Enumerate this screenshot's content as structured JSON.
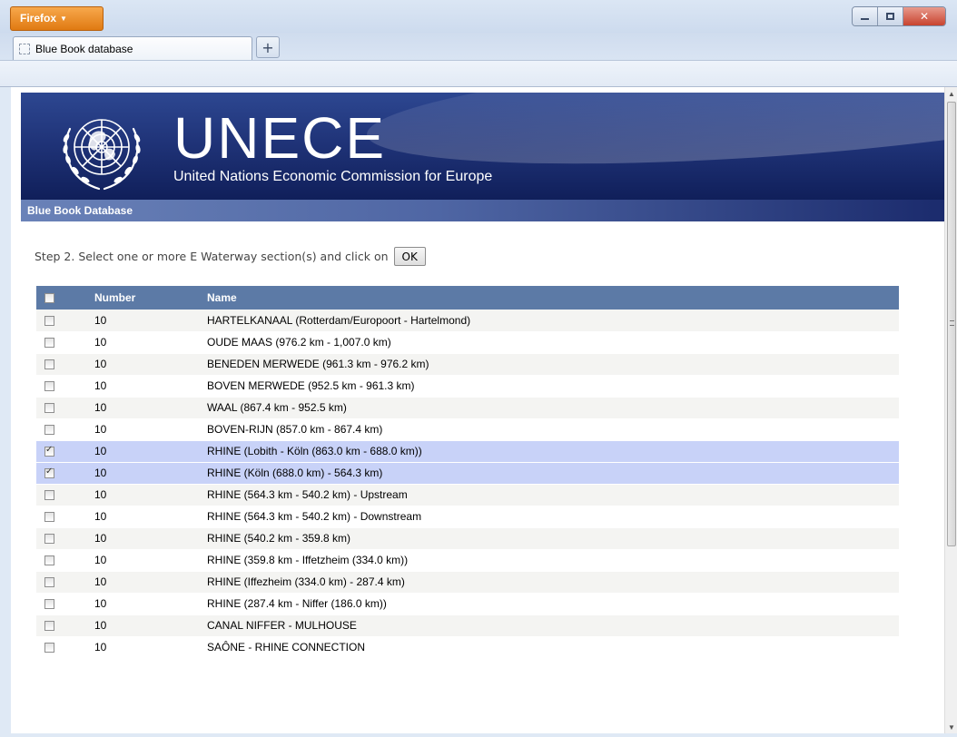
{
  "window": {
    "firefox_label": "Firefox",
    "tab_title": "Blue Book database",
    "new_tab_symbol": "+"
  },
  "banner": {
    "title": "UNECE",
    "subtitle": "United Nations Economic Commission for Europe",
    "section": "Blue Book Database"
  },
  "step": {
    "text": "Step 2. Select one or more E Waterway section(s) and click on",
    "ok_label": "OK"
  },
  "table": {
    "headers": [
      "Number",
      "Name"
    ],
    "rows": [
      {
        "checked": false,
        "number": "10",
        "name": "HARTELKANAAL (Rotterdam/Europoort - Hartelmond)"
      },
      {
        "checked": false,
        "number": "10",
        "name": "OUDE MAAS (976.2 km - 1,007.0 km)"
      },
      {
        "checked": false,
        "number": "10",
        "name": "BENEDEN MERWEDE (961.3 km - 976.2 km)"
      },
      {
        "checked": false,
        "number": "10",
        "name": "BOVEN MERWEDE (952.5 km - 961.3 km)"
      },
      {
        "checked": false,
        "number": "10",
        "name": "WAAL (867.4 km - 952.5 km)"
      },
      {
        "checked": false,
        "number": "10",
        "name": "BOVEN-RIJN (857.0 km - 867.4 km)"
      },
      {
        "checked": true,
        "number": "10",
        "name": "RHINE (Lobith - Köln (863.0 km - 688.0 km))"
      },
      {
        "checked": true,
        "number": "10",
        "name": "RHINE (Köln (688.0 km) - 564.3 km)"
      },
      {
        "checked": false,
        "number": "10",
        "name": "RHINE (564.3 km - 540.2 km) - Upstream"
      },
      {
        "checked": false,
        "number": "10",
        "name": "RHINE (564.3 km - 540.2 km) - Downstream"
      },
      {
        "checked": false,
        "number": "10",
        "name": "RHINE (540.2 km - 359.8 km)"
      },
      {
        "checked": false,
        "number": "10",
        "name": "RHINE (359.8 km - Iffetzheim (334.0 km))"
      },
      {
        "checked": false,
        "number": "10",
        "name": "RHINE (Iffezheim (334.0 km) - 287.4 km)"
      },
      {
        "checked": false,
        "number": "10",
        "name": "RHINE (287.4 km - Niffer (186.0 km))"
      },
      {
        "checked": false,
        "number": "10",
        "name": "CANAL NIFFER - MULHOUSE"
      },
      {
        "checked": false,
        "number": "10",
        "name": "SAÔNE - RHINE CONNECTION"
      }
    ]
  },
  "colors": {
    "header_bg": "#5c7aa6",
    "selected_row": "#c8d2f8",
    "banner_blue": "#203479"
  }
}
